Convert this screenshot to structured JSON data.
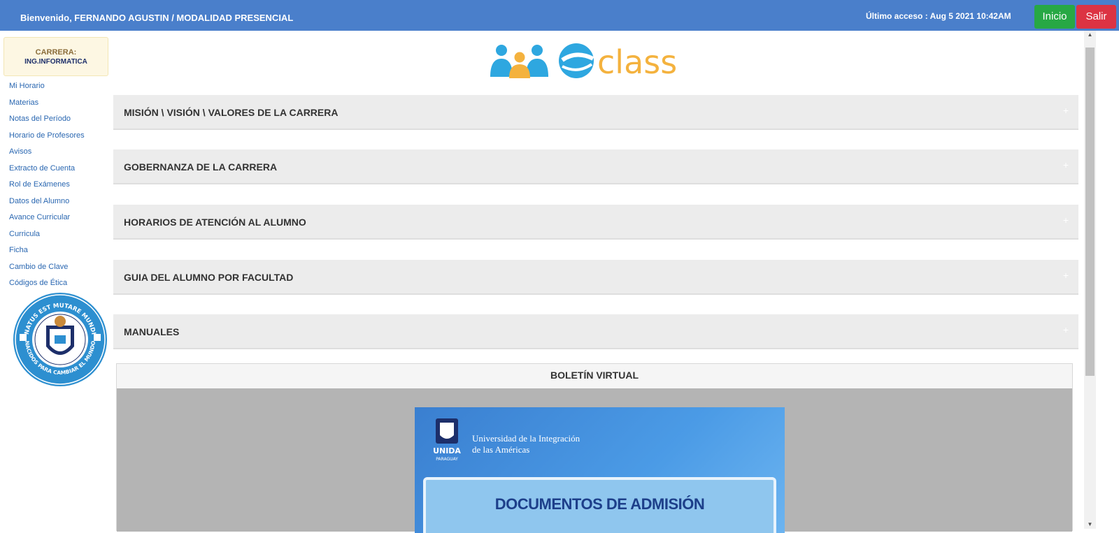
{
  "header": {
    "welcome": "Bienvenido, FERNANDO AGUSTIN / MODALIDAD PRESENCIAL",
    "last_access": "Último acceso : Aug 5 2021 10:42AM",
    "inicio_label": "Inicio",
    "salir_label": "Salir"
  },
  "sidebar": {
    "carrera_label": "CARRERA:",
    "carrera_value": "ING.INFORMATICA",
    "items": [
      "Mi Horario",
      "Materias",
      "Notas del Período",
      "Horario de Profesores",
      "Avisos",
      "Extracto de Cuenta",
      "Rol de Exámenes",
      "Datos del Alumno",
      "Avance Curricular",
      "Curricula",
      "Ficha",
      "Cambio de Clave",
      "Códigos de Ética"
    ],
    "seal_text_top": "NATUS EST MUTARE MUNDI",
    "seal_text_bottom": "NACIDOS PARA CAMBIAR EL MUNDO"
  },
  "main": {
    "logo_text": "class",
    "panels": [
      "MISIÓN \\ VISIÓN \\ VALORES DE LA CARRERA",
      "GOBERNANZA DE LA CARRERA",
      "HORARIOS DE ATENCIÓN AL ALUMNO",
      "GUIA DEL ALUMNO POR FACULTAD",
      "MANUALES"
    ],
    "panel_toggle": "+",
    "boletin_title": "BOLETÍN VIRTUAL",
    "poster": {
      "uni_line1": "Universidad de la Integración",
      "uni_line2": "de las Américas",
      "uni_short": "UNIDA",
      "country": "PARAGUAY",
      "banner_text": "DOCUMENTOS DE ADMISIÓN"
    }
  },
  "colors": {
    "header_bg": "#4a7fcb",
    "inicio_bg": "#27a844",
    "salir_bg": "#dc3343",
    "link": "#2a67b1"
  }
}
